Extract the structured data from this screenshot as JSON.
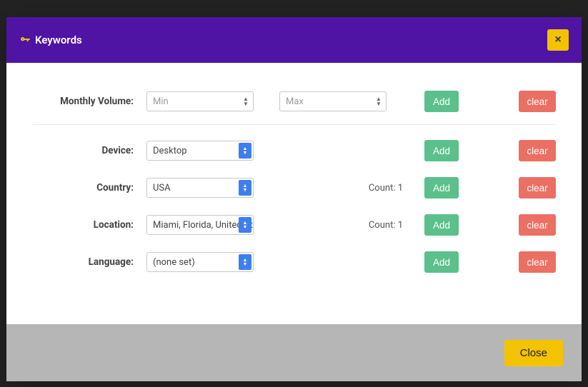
{
  "header": {
    "title": "Keywords",
    "close_x": "×"
  },
  "rows": {
    "volume": {
      "label": "Monthly Volume:",
      "min_placeholder": "Min",
      "max_placeholder": "Max",
      "add": "Add",
      "clear": "clear"
    },
    "device": {
      "label": "Device:",
      "value": "Desktop",
      "add": "Add",
      "clear": "clear"
    },
    "country": {
      "label": "Country:",
      "value": "USA",
      "count": "Count: 1",
      "add": "Add",
      "clear": "clear"
    },
    "location": {
      "label": "Location:",
      "value": "Miami, Florida, United States",
      "count": "Count: 1",
      "add": "Add",
      "clear": "clear"
    },
    "language": {
      "label": "Language:",
      "value": "(none set)",
      "add": "Add",
      "clear": "clear"
    }
  },
  "footer": {
    "close": "Close"
  }
}
